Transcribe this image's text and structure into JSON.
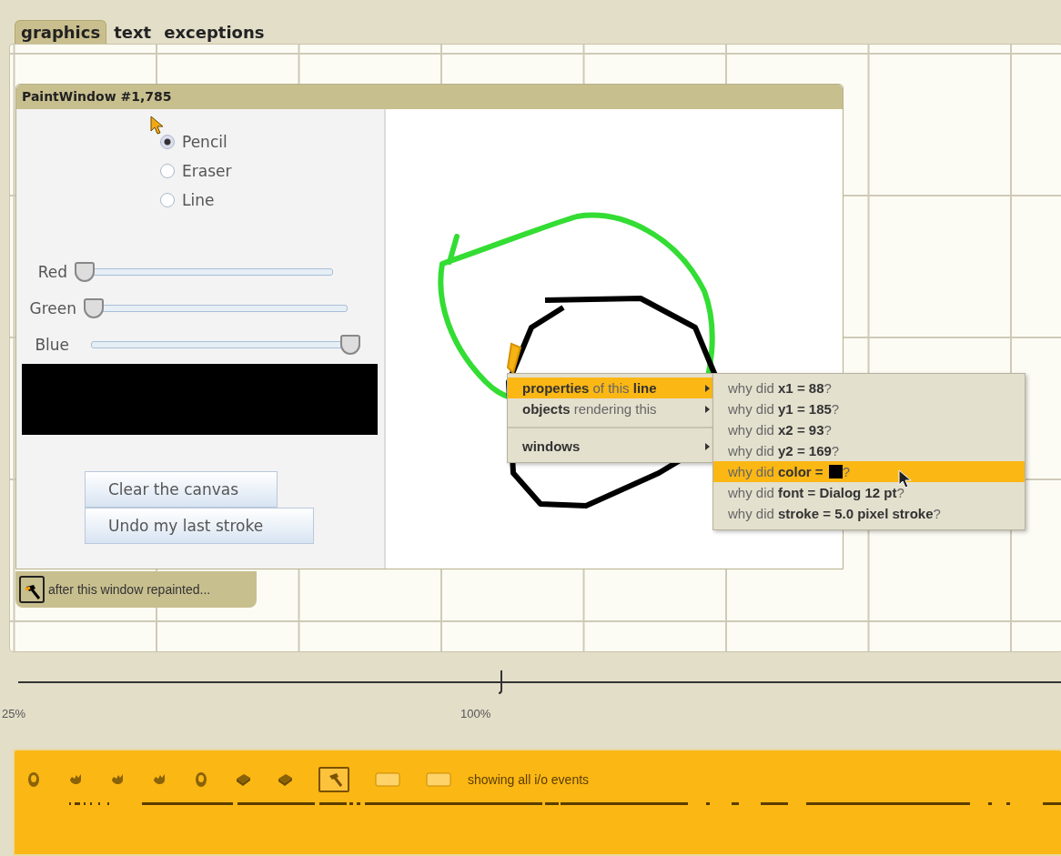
{
  "tabs": [
    {
      "label": "graphics",
      "selected": true
    },
    {
      "label": "text",
      "selected": false
    },
    {
      "label": "exceptions",
      "selected": false
    }
  ],
  "paint_window": {
    "title": "PaintWindow #1,785",
    "tools": [
      {
        "label": "Pencil",
        "selected": true
      },
      {
        "label": "Eraser",
        "selected": false
      },
      {
        "label": "Line",
        "selected": false
      }
    ],
    "sliders": [
      {
        "label": "Red",
        "level": 0
      },
      {
        "label": "Green",
        "level": 0
      },
      {
        "label": "Blue",
        "level": 1
      }
    ],
    "color_preview": {
      "color": "#000000"
    },
    "buttons": [
      "Clear the canvas",
      "Undo my last stroke"
    ]
  },
  "repaint_tooltip": "after this window repainted...",
  "context_menu": {
    "items": [
      {
        "label": "**properties** of this **line**",
        "selected": true
      },
      {
        "label": "**objects** rendering this",
        "selected": false
      },
      {
        "label": "**windows**",
        "selected": false
      }
    ]
  },
  "submenu": {
    "items": [
      {
        "kind": "text",
        "label": "why did **x1 = 88**?",
        "selected": false
      },
      {
        "kind": "text",
        "label": "why did **y1 = 185**?",
        "selected": false
      },
      {
        "kind": "text",
        "label": "why did **x2 = 93**?",
        "selected": false
      },
      {
        "kind": "text",
        "label": "why did **y2 = 169**?",
        "selected": false
      },
      {
        "kind": "color",
        "label": "why did **color =**",
        "color": "#000000",
        "after": "?",
        "selected": true
      },
      {
        "kind": "text",
        "label": "why did **font = Dialog 12 pt**?",
        "selected": false
      },
      {
        "kind": "text",
        "label": "why did **stroke = 5.0 pixel stroke**?",
        "selected": false
      }
    ]
  },
  "zoom_slider": {
    "level": 0.46,
    "labels": [
      "25%",
      "100%"
    ]
  },
  "timeline": {
    "filters": [
      {
        "kind": "mouse",
        "selected": false
      },
      {
        "kind": "hand",
        "selected": false
      },
      {
        "kind": "hand",
        "selected": false
      },
      {
        "kind": "hand",
        "selected": false
      },
      {
        "kind": "mouse",
        "selected": false
      },
      {
        "kind": "keyboard",
        "selected": false
      },
      {
        "kind": "keyboard",
        "selected": false
      },
      {
        "kind": "hammer",
        "selected": true
      },
      {
        "kind": "box",
        "selected": false
      },
      {
        "kind": "box",
        "selected": false
      }
    ],
    "status": "showing all i/o events"
  }
}
